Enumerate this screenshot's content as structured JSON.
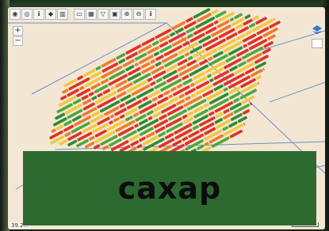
{
  "colors": {
    "map_background": "#f3e7d4",
    "field_boundary": "#6b8fc7",
    "row_palette": [
      "#e0302a",
      "#ee7a2a",
      "#f2c83a",
      "#4aa83d",
      "#2f8a34"
    ],
    "caption_background": "#2d6a30"
  },
  "toolbar": {
    "tools": [
      "globe-icon",
      "target-icon",
      "info-icon",
      "pan-arrows-icon",
      "chart-icon",
      "measure-icon",
      "grid-icon",
      "filter-icon",
      "picture-icon",
      "zoom-in-icon",
      "zoom-out-icon",
      "info-icon"
    ]
  },
  "zoom": {
    "in_label": "+",
    "out_label": "−"
  },
  "status": {
    "coordinates": "39.2..."
  },
  "caption": {
    "text": "сахар"
  }
}
